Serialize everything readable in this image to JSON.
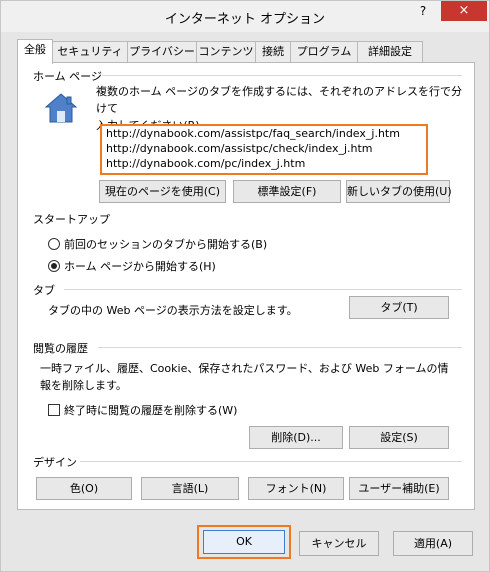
{
  "window": {
    "title": "インターネット オプション",
    "help": "?",
    "close": "×"
  },
  "tabs": [
    "全般",
    "セキュリティ",
    "プライバシー",
    "コンテンツ",
    "接続",
    "プログラム",
    "詳細設定"
  ],
  "active_tab": "全般",
  "home": {
    "header": "ホーム ページ",
    "icon": "house-icon",
    "description_line1": "複数のホーム ページのタブを作成するには、それぞれのアドレスを行で分けて",
    "description_line2": "入力してください(R)",
    "urls": [
      "http://dynabook.com/assistpc/faq_search/index_j.htm",
      "http://dynabook.com/assistpc/check/index_j.htm",
      "http://dynabook.com/pc/index_j.htm"
    ],
    "btn_current": "現在のページを使用(C)",
    "btn_default": "標準設定(F)",
    "btn_newtab": "新しいタブの使用(U)"
  },
  "startup": {
    "header": "スタートアップ",
    "option_prev": "前回のセッションのタブから開始する(B)",
    "option_home": "ホーム ページから開始する(H)",
    "selected": "home"
  },
  "tabsection": {
    "header": "タブ",
    "text": "タブの中の Web ページの表示方法を設定します。",
    "button": "タブ(T)"
  },
  "history": {
    "header": "閲覧の履歴",
    "text_line1": "一時ファイル、履歴、Cookie、保存されたパスワード、および Web フォームの情",
    "text_line2": "報を削除します。",
    "checkbox": "終了時に閲覧の履歴を削除する(W)",
    "checked": false,
    "btn_delete": "削除(D)...",
    "btn_settings": "設定(S)"
  },
  "design": {
    "header": "デザイン",
    "btn_colors": "色(O)",
    "btn_languages": "言語(L)",
    "btn_fonts": "フォント(N)",
    "btn_accessibility": "ユーザー補助(E)"
  },
  "footer": {
    "ok": "OK",
    "cancel": "キャンセル",
    "apply": "適用(A)"
  },
  "colors": {
    "highlight": "#f07a22",
    "close_red": "#c7372f"
  }
}
